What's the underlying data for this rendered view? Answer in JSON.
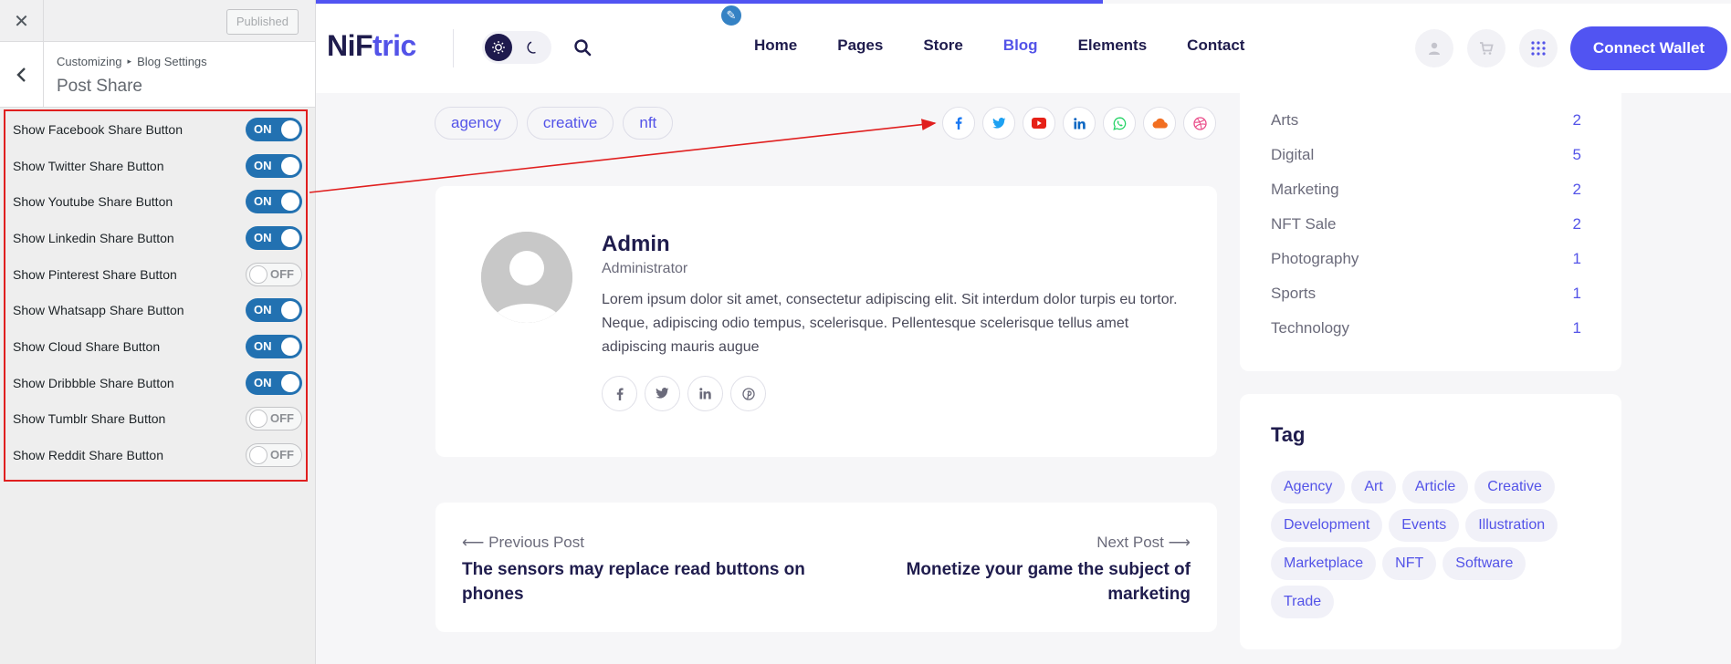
{
  "customizer": {
    "published_label": "Published",
    "breadcrumb": [
      "Customizing",
      "Blog Settings"
    ],
    "section_title": "Post Share",
    "options": [
      {
        "label": "Show Facebook Share Button",
        "state": "ON"
      },
      {
        "label": "Show Twitter Share Button",
        "state": "ON"
      },
      {
        "label": "Show Youtube Share Button",
        "state": "ON"
      },
      {
        "label": "Show Linkedin Share Button",
        "state": "ON"
      },
      {
        "label": "Show Pinterest Share Button",
        "state": "OFF"
      },
      {
        "label": "Show Whatsapp Share Button",
        "state": "ON"
      },
      {
        "label": "Show Cloud Share Button",
        "state": "ON"
      },
      {
        "label": "Show Dribbble Share Button",
        "state": "ON"
      },
      {
        "label": "Show Tumblr Share Button",
        "state": "OFF"
      },
      {
        "label": "Show Reddit Share Button",
        "state": "OFF"
      }
    ]
  },
  "site": {
    "logo_part1": "NiF",
    "logo_part2": "tric",
    "nav": [
      "Home",
      "Pages",
      "Store",
      "Blog",
      "Elements",
      "Contact"
    ],
    "active_nav": "Blog",
    "wallet_button": "Connect Wallet"
  },
  "post": {
    "tags": [
      "agency",
      "creative",
      "nft"
    ],
    "share_icons": [
      {
        "icon": "facebook-icon",
        "color": "#1877f2"
      },
      {
        "icon": "twitter-icon",
        "color": "#1da1f2"
      },
      {
        "icon": "youtube-icon",
        "color": "#e62117"
      },
      {
        "icon": "linkedin-icon",
        "color": "#0a66c2"
      },
      {
        "icon": "whatsapp-icon",
        "color": "#25d366"
      },
      {
        "icon": "cloud-icon",
        "color": "#f26f21"
      },
      {
        "icon": "dribbble-icon",
        "color": "#ea4c89"
      }
    ]
  },
  "author": {
    "name": "Admin",
    "role": "Administrator",
    "bio": "Lorem ipsum dolor sit amet, consectetur adipiscing elit. Sit interdum dolor turpis eu tortor. Neque, adipiscing odio tempus, scelerisque. Pellentesque scelerisque tellus amet adipiscing mauris augue",
    "social_icons": [
      "facebook-icon",
      "twitter-icon",
      "linkedin-icon",
      "pinterest-icon"
    ]
  },
  "post_nav": {
    "prev_label": "Previous Post",
    "prev_title": "The sensors may replace read buttons on phones",
    "next_label": "Next Post",
    "next_title": "Monetize your game the subject of marketing"
  },
  "categories": [
    {
      "name": "Arts",
      "count": "2"
    },
    {
      "name": "Digital",
      "count": "5"
    },
    {
      "name": "Marketing",
      "count": "2"
    },
    {
      "name": "NFT Sale",
      "count": "2"
    },
    {
      "name": "Photography",
      "count": "1"
    },
    {
      "name": "Sports",
      "count": "1"
    },
    {
      "name": "Technology",
      "count": "1"
    }
  ],
  "tag_widget": {
    "title": "Tag",
    "tags": [
      "Agency",
      "Art",
      "Article",
      "Creative",
      "Development",
      "Events",
      "Illustration",
      "Marketplace",
      "NFT",
      "Software",
      "Trade"
    ]
  },
  "colors": {
    "accent": "#5154f2",
    "toggle_on": "#2271b1",
    "annotation": "#e01f1f"
  }
}
